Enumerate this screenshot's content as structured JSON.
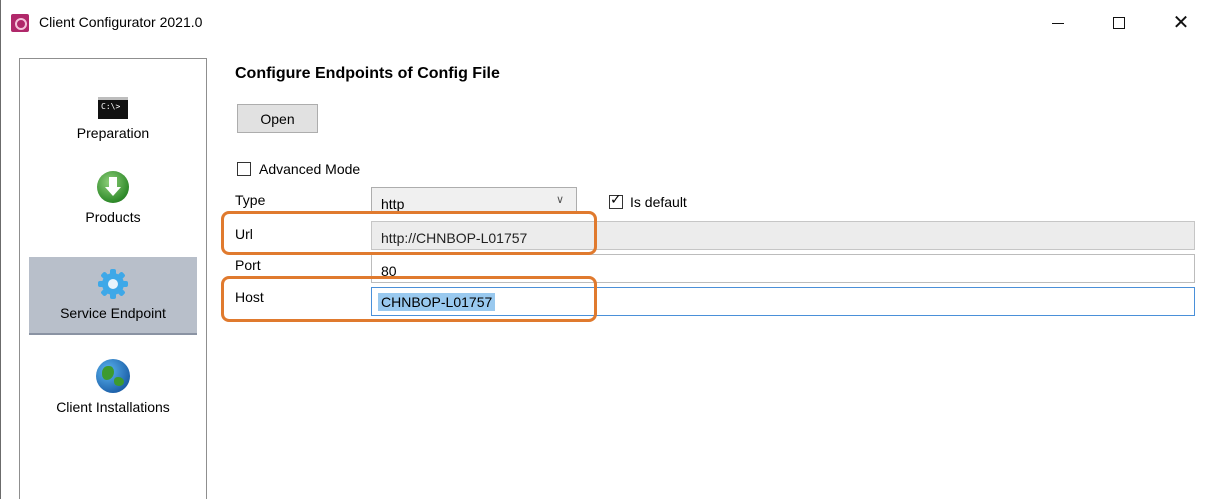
{
  "window": {
    "title": "Client Configurator 2021.0",
    "app_icon": "app-gear-icon",
    "controls": {
      "minimize": "minimize-icon",
      "maximize": "maximize-icon",
      "close": "close-icon",
      "close_glyph": "✕"
    }
  },
  "sidebar": {
    "items": [
      {
        "label": "Preparation",
        "icon": "command-prompt-icon",
        "icon_text": "C:\\>"
      },
      {
        "label": "Products",
        "icon": "download-arrow-icon"
      },
      {
        "label": "Service Endpoint",
        "icon": "gear-icon",
        "selected": true
      },
      {
        "label": "Client Installations",
        "icon": "globe-icon"
      }
    ]
  },
  "main": {
    "heading": "Configure Endpoints of Config File",
    "open_button": "Open",
    "advanced_mode": {
      "label": "Advanced Mode",
      "checked": false
    },
    "type": {
      "label": "Type",
      "value": "http",
      "is_default": {
        "label": "Is default",
        "checked": true
      }
    },
    "url": {
      "label": "Url",
      "value": "http://CHNBOP-L01757"
    },
    "port": {
      "label": "Port",
      "value": "80"
    },
    "host": {
      "label": "Host",
      "value": "CHNBOP-L01757"
    }
  },
  "colors": {
    "highlight": "#e07a2e",
    "selected_nav": "#b8bfca",
    "focus_border": "#4a90d9",
    "text_selection": "#99c9ef"
  }
}
